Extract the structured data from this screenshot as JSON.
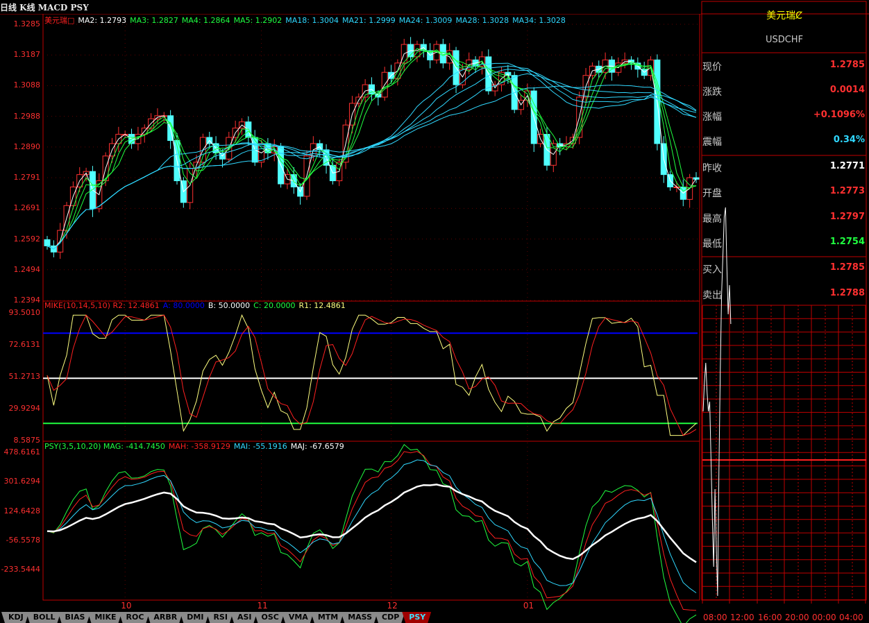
{
  "toolbar": {
    "title": "日线 K线 MACD PSY"
  },
  "main_panel": {
    "legend_name": "美元瑞□",
    "ma": [
      {
        "label": "MA2: 1.2793",
        "period": 2,
        "color": "#ffffff"
      },
      {
        "label": "MA3: 1.2827",
        "period": 3,
        "color": "#20ff40"
      },
      {
        "label": "MA4: 1.2864",
        "period": 4,
        "color": "#20ff40"
      },
      {
        "label": "MA5: 1.2902",
        "period": 5,
        "color": "#20ff40"
      },
      {
        "label": "MA18: 1.3004",
        "period": 18,
        "color": "#30d8ff"
      },
      {
        "label": "MA21: 1.2999",
        "period": 21,
        "color": "#30d8ff"
      },
      {
        "label": "MA24: 1.3009",
        "period": 24,
        "color": "#30d8ff"
      },
      {
        "label": "MA28: 1.3028",
        "period": 28,
        "color": "#30d8ff"
      },
      {
        "label": "MA34: 1.3028",
        "period": 34,
        "color": "#30d8ff"
      }
    ],
    "y_ticks": [
      "1.3285",
      "1.3187",
      "1.3088",
      "1.2988",
      "1.2890",
      "1.2791",
      "1.2691",
      "1.2592",
      "1.2494",
      "1.2394"
    ]
  },
  "mike_panel": {
    "legend": [
      {
        "text": "MIKE(10,14,5,10) R2: 12.4861",
        "color": "#ff2020"
      },
      {
        "text": "A: 80.0000",
        "color": "#0000ff"
      },
      {
        "text": "B: 50.0000",
        "color": "#ffffff"
      },
      {
        "text": "C: 20.0000",
        "color": "#20ff40"
      },
      {
        "text": "R1: 12.4861",
        "color": "#ffff80"
      }
    ],
    "y_ticks": [
      "93.5010",
      "72.6131",
      "51.2713",
      "29.9294",
      "8.5875"
    ],
    "levels": [
      80,
      50,
      20
    ]
  },
  "psy_panel": {
    "legend": [
      {
        "text": "PSY(3,5,10,20) MAG: -414.7450",
        "color": "#20ff40"
      },
      {
        "text": "MAH: -358.9129",
        "color": "#ff2020"
      },
      {
        "text": "MAI: -55.1916",
        "color": "#30d8ff"
      },
      {
        "text": "MAJ: -67.6579",
        "color": "#ffffff"
      }
    ],
    "y_ticks": [
      "478.6161",
      "301.6294",
      "124.6428",
      "-56.5578",
      "-233.5444"
    ]
  },
  "x_labels": [
    "10",
    "11",
    "12",
    "01"
  ],
  "quote": {
    "title": "美元瑞Ȼ",
    "symbol": "USDCHF",
    "rows": [
      {
        "k": "现价",
        "v": "1.2785",
        "color": "#ff3030"
      },
      {
        "k": "涨跌",
        "v": "0.0014",
        "color": "#ff3030"
      },
      {
        "k": "涨幅",
        "v": "+0.1096%",
        "color": "#ff3030"
      },
      {
        "k": "震幅",
        "v": "0.34%",
        "color": "#30d8ff"
      },
      {
        "k": "昨收",
        "v": "1.2771",
        "color": "#ffffff"
      },
      {
        "k": "开盘",
        "v": "1.2773",
        "color": "#ff3030"
      },
      {
        "k": "最高",
        "v": "1.2797",
        "color": "#ff3030"
      },
      {
        "k": "最低",
        "v": "1.2754",
        "color": "#20ff40"
      },
      {
        "k": "买入",
        "v": "1.2785",
        "color": "#ff3030"
      },
      {
        "k": "卖出",
        "v": "1.2788",
        "color": "#ff3030"
      }
    ]
  },
  "intraday": {
    "time_labels": [
      "08:00",
      "12:00",
      "16:00",
      "20:00",
      "00:00",
      "04:00"
    ],
    "prices": [
      1.2776,
      1.2779,
      1.2781,
      1.2778,
      1.2776,
      1.2777,
      1.2771,
      1.2765,
      1.276,
      1.2768,
      1.2762,
      1.2757,
      1.277,
      1.278,
      1.2788,
      1.2792,
      1.2796,
      1.2797,
      1.2791,
      1.2786,
      1.2789,
      1.2785
    ]
  },
  "tabs": [
    "KDJ",
    "BOLL",
    "BIAS",
    "MIKE",
    "ROC",
    "ARBR",
    "DMI",
    "RSI",
    "ASI",
    "OSC",
    "VMA",
    "MTM",
    "MASS",
    "CDP",
    "PSY"
  ],
  "active_tab": "PSY",
  "chart_data": {
    "type": "candlestick",
    "title": "USDCHF daily",
    "ylim": [
      1.2394,
      1.3285
    ],
    "month_labels": [
      "10",
      "11",
      "12",
      "01"
    ],
    "month_start_index": [
      12,
      33,
      53,
      74
    ],
    "close": [
      1.257,
      1.255,
      1.262,
      1.27,
      1.276,
      1.28,
      1.281,
      1.269,
      1.278,
      1.286,
      1.29,
      1.293,
      1.293,
      1.29,
      1.293,
      1.295,
      1.298,
      1.299,
      1.299,
      1.291,
      1.278,
      1.271,
      1.282,
      1.284,
      1.292,
      1.29,
      1.287,
      1.285,
      1.292,
      1.295,
      1.297,
      1.292,
      1.284,
      1.29,
      1.287,
      1.289,
      1.277,
      1.28,
      1.276,
      1.273,
      1.286,
      1.29,
      1.288,
      1.283,
      1.278,
      1.284,
      1.296,
      1.303,
      1.305,
      1.309,
      1.306,
      1.305,
      1.313,
      1.311,
      1.316,
      1.322,
      1.318,
      1.322,
      1.32,
      1.317,
      1.322,
      1.316,
      1.32,
      1.309,
      1.314,
      1.317,
      1.315,
      1.318,
      1.307,
      1.309,
      1.313,
      1.312,
      1.301,
      1.304,
      1.307,
      1.29,
      1.293,
      1.283,
      1.29,
      1.289,
      1.29,
      1.292,
      1.305,
      1.312,
      1.315,
      1.313,
      1.317,
      1.313,
      1.316,
      1.317,
      1.316,
      1.314,
      1.312,
      1.317,
      1.29,
      1.28,
      1.276,
      1.276,
      1.272,
      1.279,
      1.2785
    ]
  }
}
